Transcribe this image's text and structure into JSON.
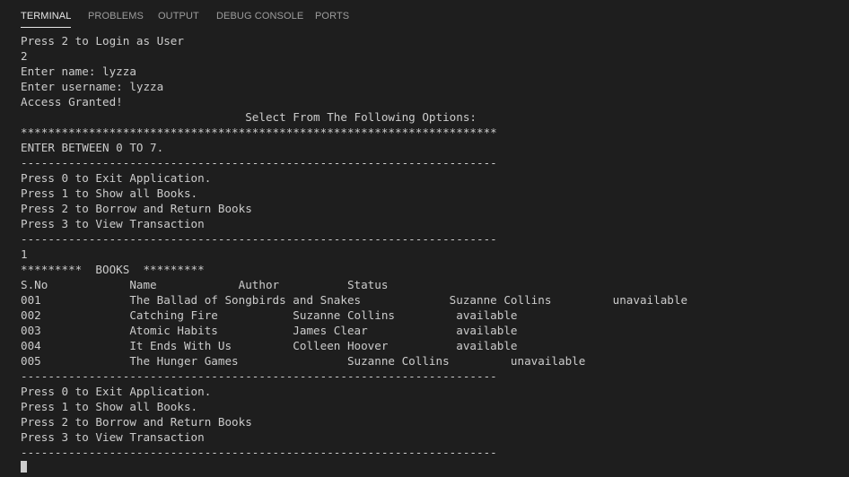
{
  "tabs": [
    {
      "label": "TERMINAL",
      "active": true
    },
    {
      "label": "PROBLEMS",
      "active": false
    },
    {
      "label": "OUTPUT",
      "active": false
    },
    {
      "label": "DEBUG CONSOLE",
      "active": false
    },
    {
      "label": "PORTS",
      "active": false
    }
  ],
  "terminal": {
    "lines": [
      "Press 2 to Login as User",
      "2",
      "Enter name: lyzza",
      "Enter username: lyzza",
      "Access Granted!",
      "                                 Select From The Following Options:",
      "**********************************************************************",
      "ENTER BETWEEN 0 TO 7.",
      "----------------------------------------------------------------------",
      "Press 0 to Exit Application.",
      "Press 1 to Show all Books.",
      "Press 2 to Borrow and Return Books",
      "Press 3 to View Transaction",
      "----------------------------------------------------------------------",
      "1",
      "*********  BOOKS  *********",
      "S.No            Name            Author          Status",
      "001             The Ballad of Songbirds and Snakes             Suzanne Collins         unavailable",
      "002             Catching Fire           Suzanne Collins         available",
      "003             Atomic Habits           James Clear             available",
      "004             It Ends With Us         Colleen Hoover          available",
      "005             The Hunger Games                Suzanne Collins         unavailable",
      "----------------------------------------------------------------------",
      "Press 0 to Exit Application.",
      "Press 1 to Show all Books.",
      "Press 2 to Borrow and Return Books",
      "Press 3 to View Transaction",
      "----------------------------------------------------------------------"
    ]
  },
  "colors": {
    "background": "#1e1e1e",
    "text": "#cccccc",
    "tab_active": "#e7e7e7",
    "tab_inactive": "#9d9d9d"
  }
}
